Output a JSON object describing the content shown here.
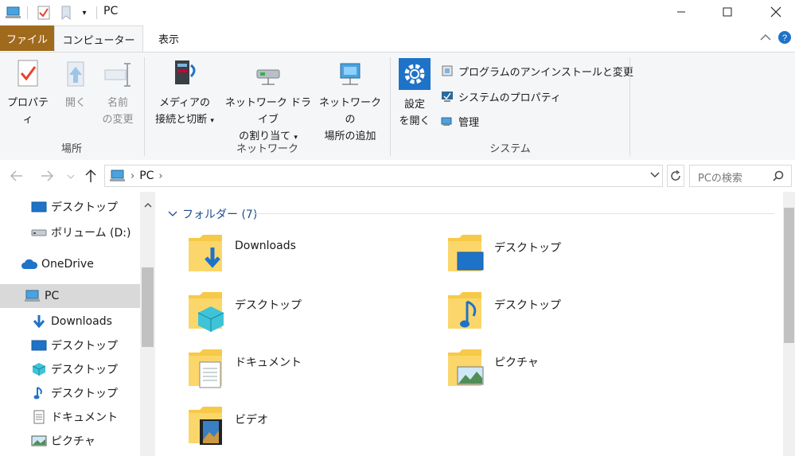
{
  "window": {
    "title": "PC"
  },
  "tabs": {
    "file": "ファイル",
    "computer": "コンピューター",
    "view": "表示"
  },
  "ribbon": {
    "location": {
      "label": "場所",
      "properties": "プロパティ",
      "open": "開く",
      "rename_line1": "名前",
      "rename_line2": "の変更"
    },
    "network": {
      "label": "ネットワーク",
      "media_line1": "メディアの",
      "media_line2": "接続と切断",
      "map_line1": "ネットワーク ドライブ",
      "map_line2": "の割り当て",
      "addloc_line1": "ネットワークの",
      "addloc_line2": "場所の追加"
    },
    "system": {
      "label": "システム",
      "settings_line1": "設定",
      "settings_line2": "を開く",
      "uninstall": "プログラムのアンインストールと変更",
      "sysprops": "システムのプロパティ",
      "manage": "管理"
    }
  },
  "address": {
    "crumb": "PC",
    "search_placeholder": "PCの検索"
  },
  "nav": {
    "items": [
      {
        "label": "デスクトップ",
        "icon": "desktop-icon"
      },
      {
        "label": "ボリューム (D:)",
        "icon": "drive-icon"
      },
      {
        "label": "OneDrive",
        "icon": "onedrive-icon"
      },
      {
        "label": "PC",
        "icon": "pc-icon"
      },
      {
        "label": "Downloads",
        "icon": "downloads-icon"
      },
      {
        "label": "デスクトップ",
        "icon": "desktop-icon"
      },
      {
        "label": "デスクトップ",
        "icon": "3d-objects-icon"
      },
      {
        "label": "デスクトップ",
        "icon": "music-icon"
      },
      {
        "label": "ドキュメント",
        "icon": "documents-icon"
      },
      {
        "label": "ピクチャ",
        "icon": "pictures-icon"
      }
    ]
  },
  "content": {
    "section_title": "フォルダー (7)",
    "folders": [
      {
        "name": "Downloads",
        "icon": "downloads-folder-icon"
      },
      {
        "name": "デスクトップ",
        "icon": "desktop-folder-icon"
      },
      {
        "name": "デスクトップ",
        "icon": "3d-objects-folder-icon"
      },
      {
        "name": "デスクトップ",
        "icon": "music-folder-icon"
      },
      {
        "name": "ドキュメント",
        "icon": "documents-folder-icon"
      },
      {
        "name": "ピクチャ",
        "icon": "pictures-folder-icon"
      },
      {
        "name": "ビデオ",
        "icon": "videos-folder-icon"
      }
    ]
  },
  "colors": {
    "file_tab": "#a06a1d",
    "ribbon_bg": "#f5f6f7",
    "accent": "#0078d7",
    "folder": "#f7c948",
    "selected": "#cce8ff"
  }
}
